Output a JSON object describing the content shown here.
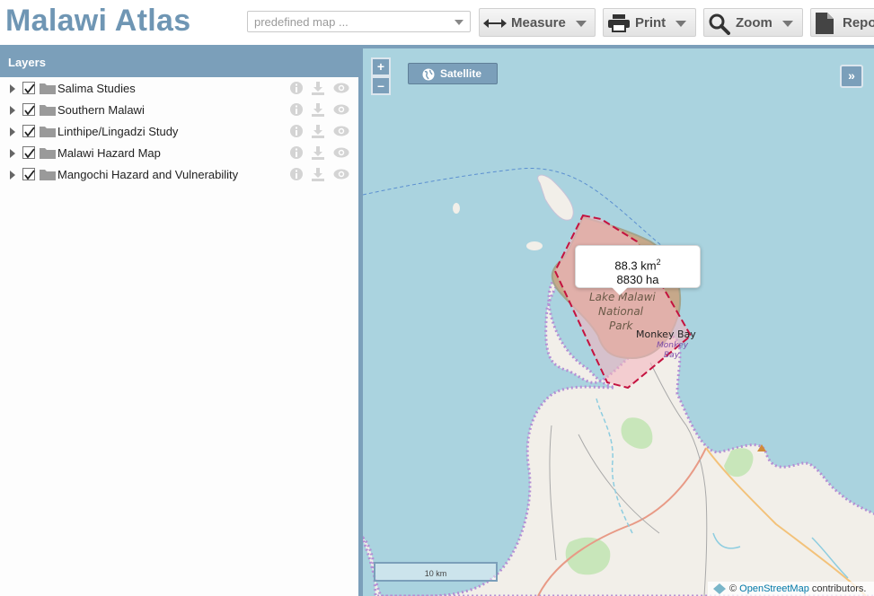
{
  "app": {
    "title": "Malawi Atlas"
  },
  "toolbar": {
    "predefined_placeholder": "predefined map ...",
    "measure_label": "Measure",
    "print_label": "Print",
    "zoom_label": "Zoom",
    "report_label": "Repo"
  },
  "layers_panel": {
    "header": "Layers",
    "items": [
      {
        "label": "Salima Studies",
        "checked": true
      },
      {
        "label": "Southern Malawi",
        "checked": true
      },
      {
        "label": "Linthipe/Lingadzi Study",
        "checked": true
      },
      {
        "label": "Malawi Hazard Map",
        "checked": true
      },
      {
        "label": "Mangochi Hazard and Vulnerability",
        "checked": true
      }
    ],
    "item_icons": [
      "info-icon",
      "download-icon",
      "eye-icon"
    ]
  },
  "map": {
    "zoom_in": "+",
    "zoom_out": "–",
    "satellite_label": "Satellite",
    "expand_label": "»",
    "measure_result": {
      "area_km2": "88.3 km",
      "area_km2_sup": "2",
      "area_ha": "8830 ha"
    },
    "labels": {
      "park_line1": "Lake Malawi",
      "park_line2": "National",
      "park_line3": "Park",
      "monkey_bay": "Monkey Bay",
      "monkey_bay_small1": "Monkey",
      "monkey_bay_small2": "Bay"
    },
    "scale_label": "10 km",
    "attribution": {
      "prefix": "© ",
      "link": "OpenStreetMap",
      "suffix": " contributors."
    },
    "colors": {
      "water": "#aad3df",
      "land": "#f2efe9",
      "park": "#c6a88a",
      "measure_fill": "#f4b6bf",
      "measure_stroke": "#c4123f",
      "ui_accent": "#7b9fba"
    }
  }
}
